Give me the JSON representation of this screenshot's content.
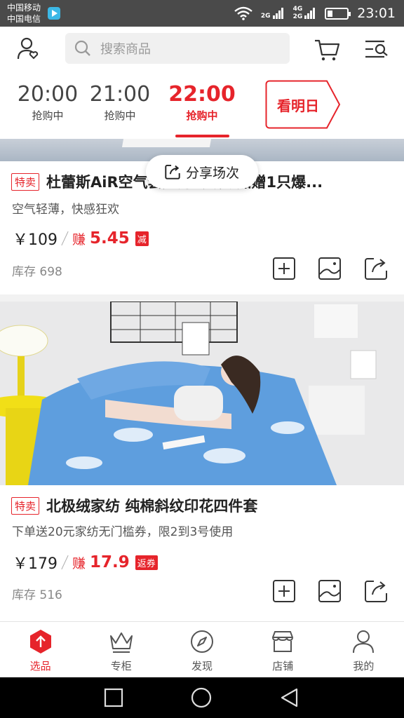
{
  "status_bar": {
    "carrier_1": "中国移动",
    "carrier_2": "中国电信",
    "sig1_label": "2G",
    "sig2_label_top": "4G",
    "sig2_label_bottom": "2G",
    "time": "23:01"
  },
  "header": {
    "search_placeholder": "搜索商品"
  },
  "sessions": [
    {
      "time": "20:00",
      "status": "抢购中",
      "active": false
    },
    {
      "time": "21:00",
      "status": "抢购中",
      "active": false
    },
    {
      "time": "22:00",
      "status": "抢购中",
      "active": true
    }
  ],
  "tomorrow_label": "看明日",
  "share_pill_label": "分享场次",
  "products": [
    {
      "tag": "特卖",
      "title": "杜蕾斯AiR空气套超薄6只装 加赠1只爆...",
      "subtitle": "空气轻薄，快感狂欢",
      "price": "￥109",
      "earn_label": "赚",
      "earn_value": "5.45",
      "earn_badge": "减",
      "stock": "库存 698"
    },
    {
      "tag": "特卖",
      "title": "北极绒家纺 纯棉斜纹印花四件套",
      "subtitle": "下单送20元家纺无门槛券，限2到3号使用",
      "price": "￥179",
      "earn_label": "赚",
      "earn_value": "17.9",
      "earn_badge": "返券",
      "stock": "库存 516"
    }
  ],
  "bottom_nav": [
    {
      "label": "选品",
      "icon": "select-icon",
      "active": true
    },
    {
      "label": "专柜",
      "icon": "crown-icon",
      "active": false
    },
    {
      "label": "发现",
      "icon": "compass-icon",
      "active": false
    },
    {
      "label": "店铺",
      "icon": "store-icon",
      "active": false
    },
    {
      "label": "我的",
      "icon": "person-icon",
      "active": false
    }
  ],
  "colors": {
    "accent": "#e6242b",
    "status_bar": "#4a4a4a"
  }
}
